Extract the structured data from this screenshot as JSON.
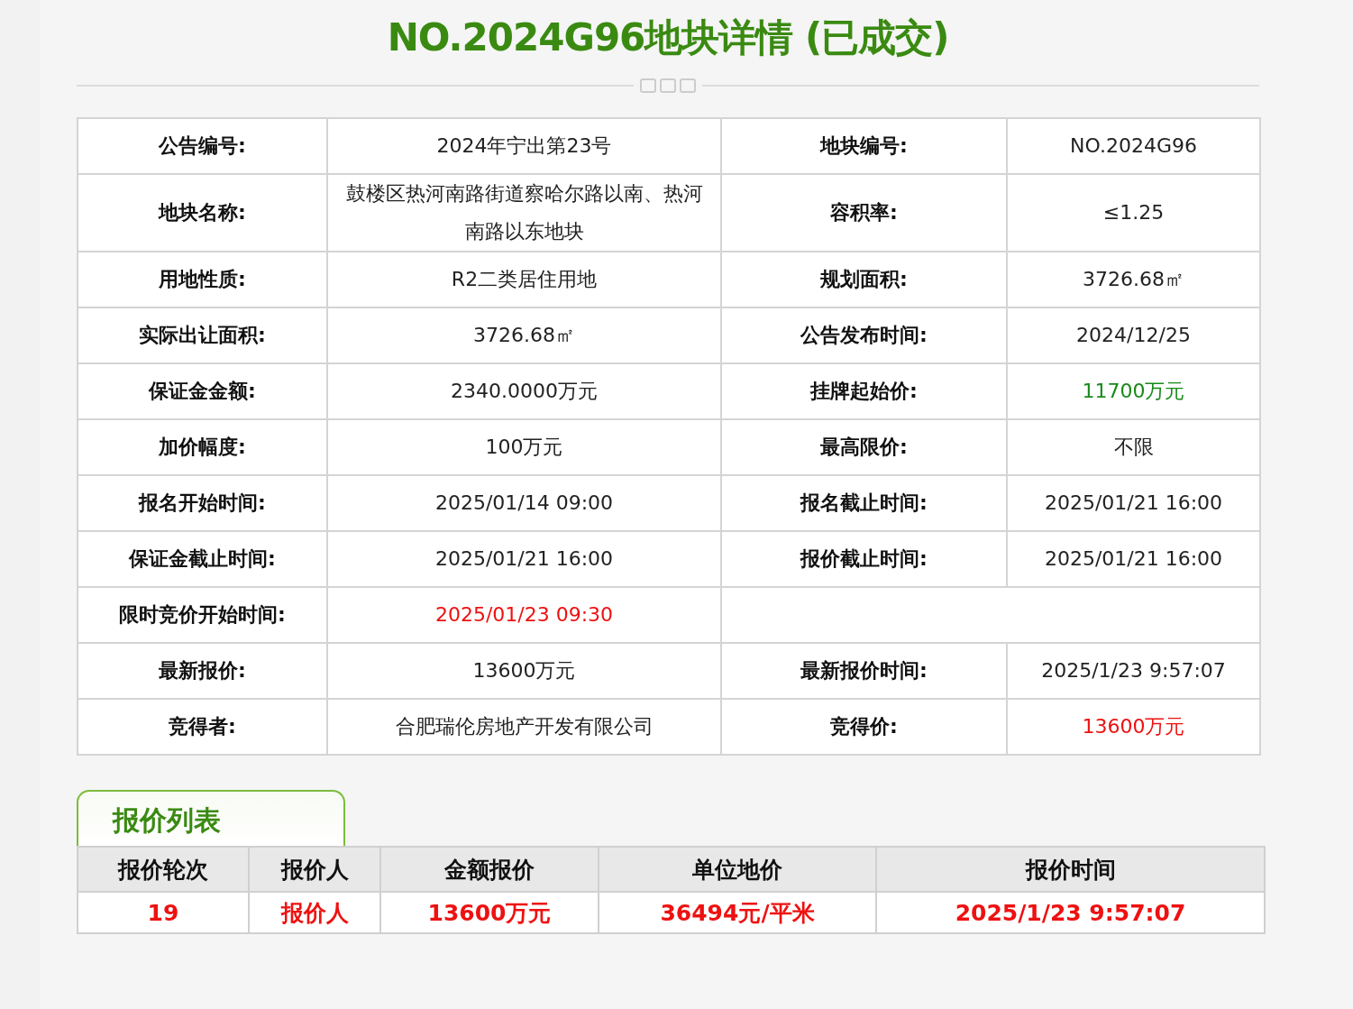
{
  "title": "NO.2024G96地块详情 (已成交)",
  "details": [
    {
      "pairs": [
        {
          "label": "公告编号:",
          "value": "2024年宁出第23号"
        },
        {
          "label": "地块编号:",
          "value": "NO.2024G96"
        }
      ]
    },
    {
      "pairs": [
        {
          "label": "地块名称:",
          "value": "鼓楼区热河南路街道察哈尔路以南、热河南路以东地块"
        },
        {
          "label": "容积率:",
          "value": "≤1.25"
        }
      ]
    },
    {
      "pairs": [
        {
          "label": "用地性质:",
          "value": "R2二类居住用地"
        },
        {
          "label": "规划面积:",
          "value": "3726.68㎡"
        }
      ]
    },
    {
      "pairs": [
        {
          "label": "实际出让面积:",
          "value": "3726.68㎡"
        },
        {
          "label": "公告发布时间:",
          "value": "2024/12/25"
        }
      ]
    },
    {
      "pairs": [
        {
          "label": "保证金金额:",
          "value": "2340.0000万元"
        },
        {
          "label": "挂牌起始价:",
          "value": "11700万元",
          "color": "#1a8a1a"
        }
      ]
    },
    {
      "pairs": [
        {
          "label": "加价幅度:",
          "value": "100万元"
        },
        {
          "label": "最高限价:",
          "value": "不限"
        }
      ]
    },
    {
      "pairs": [
        {
          "label": "报名开始时间:",
          "value": "2025/01/14 09:00"
        },
        {
          "label": "报名截止时间:",
          "value": "2025/01/21 16:00"
        }
      ]
    },
    {
      "pairs": [
        {
          "label": "保证金截止时间:",
          "value": "2025/01/21 16:00"
        },
        {
          "label": "报价截止时间:",
          "value": "2025/01/21 16:00"
        }
      ]
    },
    {
      "pairs": [
        {
          "label": "限时竞价开始时间:",
          "value": "2025/01/23 09:30",
          "color": "#ee1111"
        }
      ]
    },
    {
      "pairs": [
        {
          "label": "最新报价:",
          "value": "13600万元"
        },
        {
          "label": "最新报价时间:",
          "value": "2025/1/23 9:57:07"
        }
      ]
    },
    {
      "pairs": [
        {
          "label": "竞得者:",
          "value": "合肥瑞伦房地产开发有限公司"
        },
        {
          "label": "竞得价:",
          "value": "13600万元",
          "color": "#ee1111"
        }
      ]
    }
  ],
  "bids_tab": "报价列表",
  "bids": {
    "columns": [
      "报价轮次",
      "报价人",
      "金额报价",
      "单位地价",
      "报价时间"
    ],
    "rows": [
      [
        "19",
        "报价人",
        "13600万元",
        "36494元/平米",
        "2025/1/23 9:57:07"
      ]
    ]
  }
}
